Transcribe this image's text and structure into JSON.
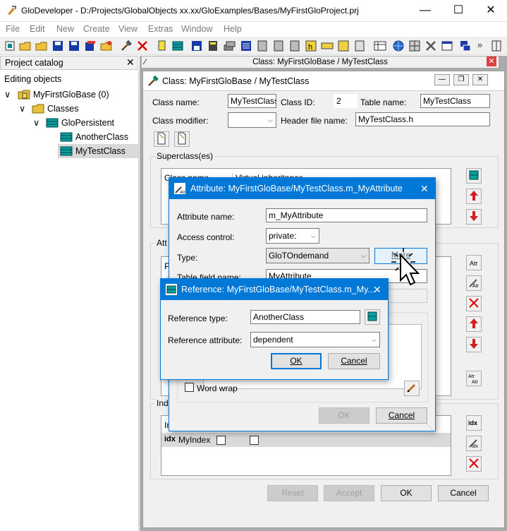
{
  "window": {
    "title": "GloDeveloper - D:/Projects/GlobalObjects xx.xx/GloExamples/Bases/MyFirstGloProject.prj"
  },
  "menu": [
    "File",
    "Edit",
    "New",
    "Create",
    "View",
    "Extras",
    "Window",
    "Help"
  ],
  "panel": {
    "title": "Project catalog",
    "editing": "Editing objects"
  },
  "tree": {
    "base": "MyFirstGloBase (0)",
    "classes": "Classes",
    "persistent": "GloPersistent",
    "another": "AnotherClass",
    "mytest": "MyTestClass"
  },
  "mdi": {
    "tab_title": "Class: MyFirstGloBase / MyTestClass"
  },
  "classwin": {
    "title": "Class: MyFirstGloBase / MyTestClass",
    "class_name_label": "Class name:",
    "class_name": "MyTestClass",
    "class_id_label": "Class ID:",
    "class_id": "2",
    "table_name_label": "Table name:",
    "table_name": "MyTestClass",
    "modifier_label": "Class modifier:",
    "header_label": "Header file name:",
    "header": "MyTestClass.h",
    "superclass_group": "Superclass(es)",
    "sc_col1": "Class name",
    "sc_col2": "Virtual inheritance",
    "attr_group": "Att",
    "attr_row": "P",
    "index_group": "Ind",
    "idx_head": "In",
    "idx_row": "MyIndex",
    "reset": "Reset",
    "accept": "Accept",
    "ok": "OK",
    "cancel": "Cancel"
  },
  "attrdlg": {
    "title": "Attribute: MyFirstGloBase/MyTestClass.m_MyAttribute",
    "name_label": "Attribute name:",
    "name": "m_MyAttribute",
    "access_label": "Access control:",
    "access": "private:",
    "type_label": "Type:",
    "type": "GloTOndemand",
    "more": "More",
    "tfield_label": "Table field name:",
    "tfield": "MyAttribute",
    "wordwrap": "Word wrap",
    "ok": "OK",
    "cancel": "Cancel"
  },
  "refdlg": {
    "title": "Reference: MyFirstGloBase/MyTestClass.m_My...",
    "type_label": "Reference type:",
    "type": "AnotherClass",
    "attr_label": "Reference attribute:",
    "attr": "dependent",
    "ok": "OK",
    "cancel": "Cancel"
  }
}
